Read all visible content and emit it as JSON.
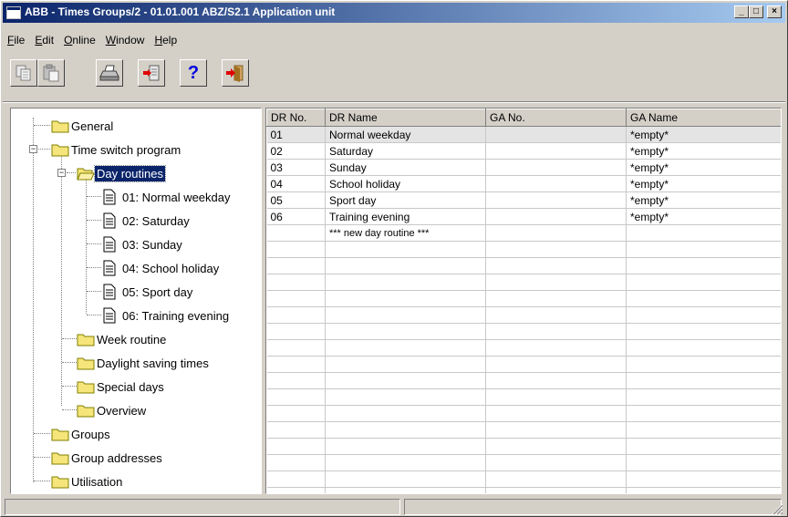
{
  "window": {
    "title": "ABB - Times Groups/2 - 01.01.001 ABZ/S2.1 Application unit",
    "controls": {
      "minimize": "_",
      "maximize": "□",
      "close": "×"
    }
  },
  "menu": [
    {
      "label": "File",
      "key": "F",
      "rest": "ile"
    },
    {
      "label": "Edit",
      "key": "E",
      "rest": "dit"
    },
    {
      "label": "Online",
      "key": "O",
      "rest": "nline"
    },
    {
      "label": "Window",
      "key": "W",
      "rest": "indow"
    },
    {
      "label": "Help",
      "key": "H",
      "rest": "elp"
    }
  ],
  "toolbar": {
    "buttons": [
      {
        "icon": "copy-icon"
      },
      {
        "icon": "paste-icon"
      },
      {
        "icon": "print-icon"
      },
      {
        "icon": "import-icon"
      },
      {
        "icon": "help-icon",
        "glyph": "?"
      },
      {
        "icon": "exit-icon"
      }
    ]
  },
  "tree": {
    "items": [
      {
        "label": "General",
        "type": "folder",
        "level": 0
      },
      {
        "label": "Time switch program",
        "type": "folder",
        "level": 0,
        "expander": "−"
      },
      {
        "label": "Day routines",
        "type": "folder-open",
        "level": 1,
        "expander": "−",
        "selected": true
      },
      {
        "label": "01: Normal weekday",
        "type": "document",
        "level": 2
      },
      {
        "label": "02: Saturday",
        "type": "document",
        "level": 2
      },
      {
        "label": "03: Sunday",
        "type": "document",
        "level": 2
      },
      {
        "label": "04: School holiday",
        "type": "document",
        "level": 2
      },
      {
        "label": "05: Sport day",
        "type": "document",
        "level": 2
      },
      {
        "label": "06: Training evening",
        "type": "document",
        "level": 2
      },
      {
        "label": "Week routine",
        "type": "folder",
        "level": 1
      },
      {
        "label": "Daylight saving times",
        "type": "folder",
        "level": 1
      },
      {
        "label": "Special days",
        "type": "folder",
        "level": 1
      },
      {
        "label": "Overview",
        "type": "folder",
        "level": 1
      },
      {
        "label": "Groups",
        "type": "folder",
        "level": 0
      },
      {
        "label": "Group addresses",
        "type": "folder",
        "level": 0
      },
      {
        "label": "Utilisation",
        "type": "folder",
        "level": 0
      }
    ]
  },
  "table": {
    "columns": [
      "DR No.",
      "DR Name",
      "GA No.",
      "GA Name"
    ],
    "rows": [
      [
        "01",
        "Normal weekday",
        "",
        "*empty*"
      ],
      [
        "02",
        "Saturday",
        "",
        "*empty*"
      ],
      [
        "03",
        "Sunday",
        "",
        "*empty*"
      ],
      [
        "04",
        "School holiday",
        "",
        "*empty*"
      ],
      [
        "05",
        "Sport day",
        "",
        "*empty*"
      ],
      [
        "06",
        "Training evening",
        "",
        "*empty*"
      ],
      [
        "",
        "*** new day routine ***",
        "",
        ""
      ]
    ]
  },
  "colors": {
    "title_active": "#0a246a",
    "title_gradient_end": "#a6caf0",
    "window_face": "#d4d0c8",
    "folder_yellow": "#f5e57a"
  }
}
